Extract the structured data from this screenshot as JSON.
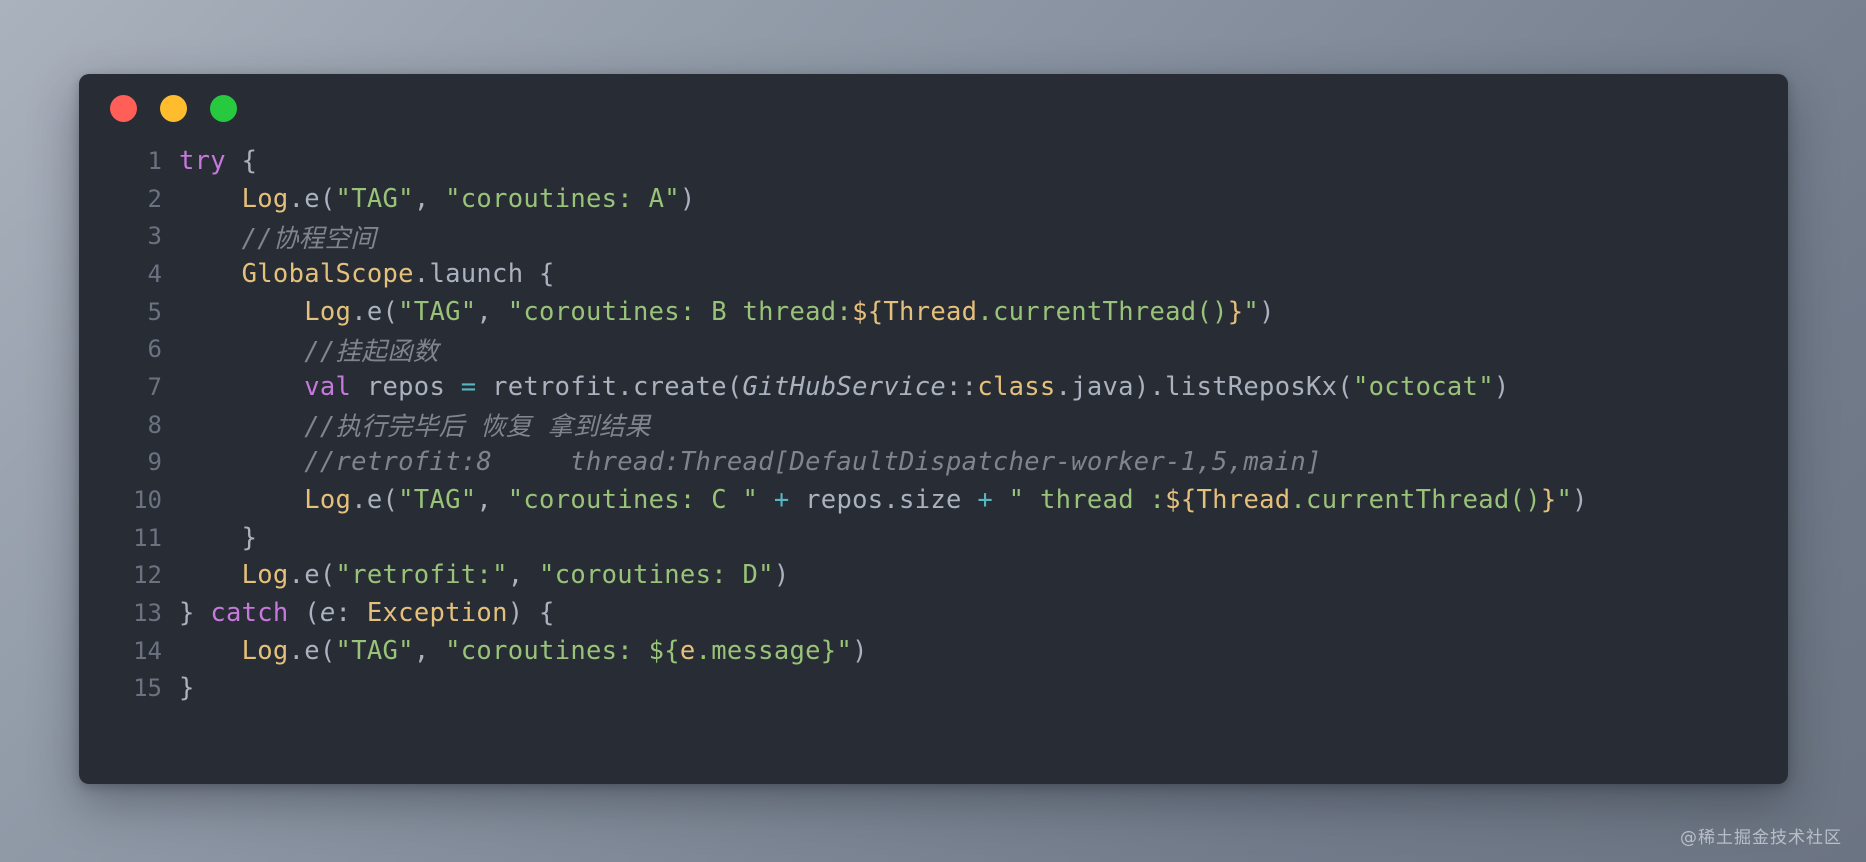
{
  "window": {
    "title_bar": {
      "close_label": "close",
      "minimize_label": "minimize",
      "maximize_label": "maximize",
      "colors": {
        "close": "#ff5f56",
        "minimize": "#ffbd2e",
        "maximize": "#27c93f"
      }
    },
    "background": "#282c34",
    "page_background_from": "#aab2bd",
    "page_background_to": "#6b7482"
  },
  "editor": {
    "language": "Kotlin",
    "gutter_numbers": [
      "1",
      "2",
      "3",
      "4",
      "5",
      "6",
      "7",
      "8",
      "9",
      "10",
      "11",
      "12",
      "13",
      "14",
      "15"
    ],
    "theme": {
      "keyword": "#c678dd",
      "identifier": "#e5c07b",
      "string": "#98c379",
      "operator": "#56b6c2",
      "comment": "#7f848e",
      "plain": "#abb2bf",
      "gutter": "#6b7280"
    },
    "lines": [
      {
        "n": "1",
        "text": "try {"
      },
      {
        "n": "2",
        "text": "    Log.e(\"TAG\", \"coroutines: A\")"
      },
      {
        "n": "3",
        "text": "    //协程空间"
      },
      {
        "n": "4",
        "text": "    GlobalScope.launch {"
      },
      {
        "n": "5",
        "text": "        Log.e(\"TAG\", \"coroutines: B thread:${Thread.currentThread()}\")"
      },
      {
        "n": "6",
        "text": "        //挂起函数"
      },
      {
        "n": "7",
        "text": "        val repos = retrofit.create(GitHubService::class.java).listReposKx(\"octocat\")"
      },
      {
        "n": "8",
        "text": "        //执行完毕后 恢复 拿到结果"
      },
      {
        "n": "9",
        "text": "        //retrofit:8     thread:Thread[DefaultDispatcher-worker-1,5,main]"
      },
      {
        "n": "10",
        "text": "        Log.e(\"TAG\", \"coroutines: C \" + repos.size + \" thread :${Thread.currentThread()}\")"
      },
      {
        "n": "11",
        "text": "    }"
      },
      {
        "n": "12",
        "text": "    Log.e(\"retrofit:\", \"coroutines: D\")"
      },
      {
        "n": "13",
        "text": "} catch (e: Exception) {"
      },
      {
        "n": "14",
        "text": "    Log.e(\"TAG\", \"coroutines: ${e.message}\")"
      },
      {
        "n": "15",
        "text": "}"
      }
    ],
    "tokens": {
      "l1": {
        "kw": "try",
        "rest": " {"
      },
      "l2": {
        "indent": "    ",
        "ident": "Log",
        "fn": ".e",
        "open": "(",
        "s1": "\"TAG\"",
        "comma": ", ",
        "s2": "\"coroutines: A\"",
        "close": ")"
      },
      "l3": {
        "indent": "    ",
        "comment": "//协程空间"
      },
      "l4": {
        "indent": "    ",
        "ident": "GlobalScope",
        "fn": ".launch",
        "rest": " {"
      },
      "l5": {
        "indent": "        ",
        "ident": "Log",
        "fn": ".e",
        "open": "(",
        "s1": "\"TAG\"",
        "comma": ", ",
        "s2a": "\"coroutines: B thread:",
        "dollar": "${",
        "tm_ident": "Thread",
        "tm_call": ".currentThread()",
        "brace": "}",
        "s2b": "\"",
        "close": ")"
      },
      "l6": {
        "indent": "        ",
        "comment": "//挂起函数"
      },
      "l7": {
        "indent": "        ",
        "kw": "val",
        "name": " repos ",
        "eq": "=",
        "call": " retrofit.create(",
        "type": "GitHubService",
        "colons": "::",
        "cls": "class",
        "java": ".java).listReposKx(",
        "str": "\"octocat\"",
        "close": ")"
      },
      "l8": {
        "indent": "        ",
        "comment": "//执行完毕后 恢复 拿到结果"
      },
      "l9": {
        "indent": "        ",
        "comment": "//retrofit:8     thread:Thread[DefaultDispatcher-worker-1,5,main]"
      },
      "l10": {
        "indent": "        ",
        "ident": "Log",
        "fn": ".e",
        "open": "(",
        "s1": "\"TAG\"",
        "comma": ", ",
        "s2": "\"coroutines: C \"",
        "plus1": " + ",
        "expr": "repos.size",
        "plus2": " + ",
        "s3": "\" thread :",
        "dollar": "${",
        "tm_ident": "Thread",
        "tm_call": ".currentThread()",
        "brace": "}",
        "s4": "\"",
        "close": ")"
      },
      "l11": {
        "indent": "    ",
        "brace": "}"
      },
      "l12": {
        "indent": "    ",
        "ident": "Log",
        "fn": ".e",
        "open": "(",
        "s1": "\"retrofit:\"",
        "comma": ", ",
        "s2": "\"coroutines: D\"",
        "close": ")"
      },
      "l13": {
        "brace": "} ",
        "kw": "catch",
        "paren": " (",
        "param": "e",
        "colon": ": ",
        "type": "Exception",
        "rest": ") {"
      },
      "l14": {
        "indent": "    ",
        "ident": "Log",
        "fn": ".e",
        "open": "(",
        "s1": "\"TAG\"",
        "comma": ", ",
        "s2a": "\"coroutines: ",
        "dollar": "${",
        "tm_ident": "e",
        "tm_call": ".message",
        "brace": "}",
        "s2b": "\"",
        "close": ")"
      },
      "l15": {
        "brace": "}"
      }
    }
  },
  "watermark": {
    "text": "@稀土掘金技术社区"
  }
}
